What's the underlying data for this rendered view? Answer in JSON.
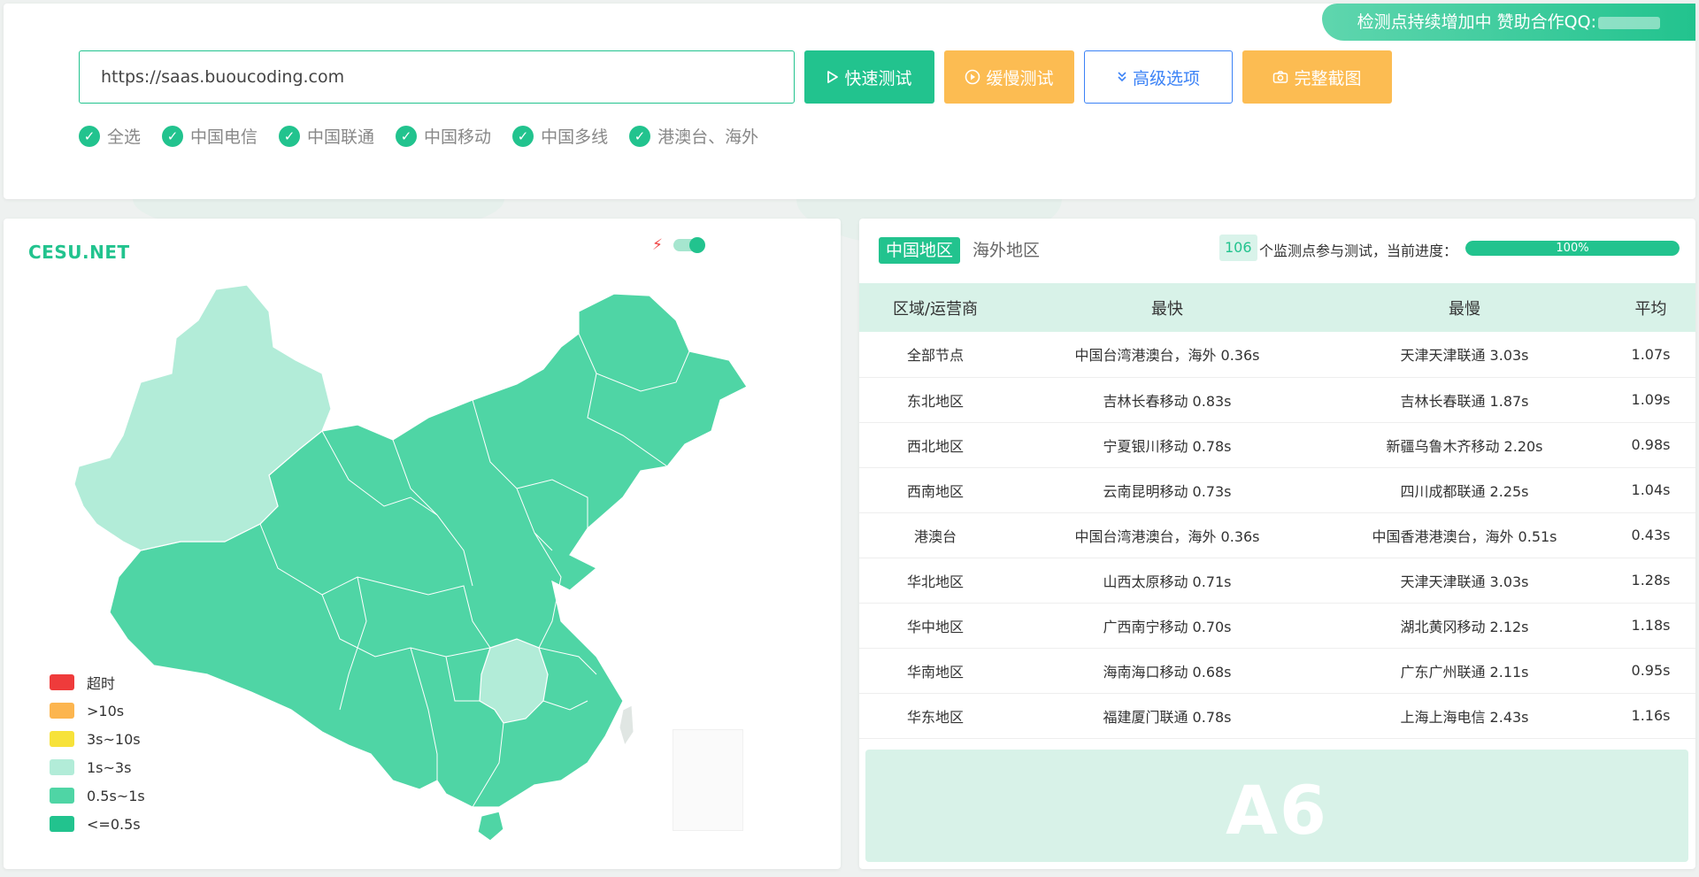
{
  "promo": {
    "text": "检测点持续增加中 赞助合作QQ:"
  },
  "url_input": {
    "value": "https://saas.buoucoding.com"
  },
  "buttons": {
    "fast": "快速测试",
    "slow": "缓慢测试",
    "advanced": "高级选项",
    "screenshot": "完整截图"
  },
  "isp_filters": [
    "全选",
    "中国电信",
    "中国联通",
    "中国移动",
    "中国多线",
    "港澳台、海外"
  ],
  "map": {
    "logo": "CESU.NET",
    "legend": [
      {
        "label": "超时",
        "color": "#ef3b3b"
      },
      {
        "label": ">10s",
        "color": "#fcb54f"
      },
      {
        "label": "3s~10s",
        "color": "#f7e23a"
      },
      {
        "label": "1s~3s",
        "color": "#b2ecd8"
      },
      {
        "label": "0.5s~1s",
        "color": "#4fd5a5"
      },
      {
        "label": "<=0.5s",
        "color": "#22c38e"
      }
    ]
  },
  "results": {
    "tabs": [
      "中国地区",
      "海外地区"
    ],
    "node_count": "106",
    "count_text": "个监测点参与测试，当前进度：",
    "progress": 100,
    "progress_label": "100%",
    "columns": [
      "区域/运营商",
      "最快",
      "最慢",
      "平均"
    ],
    "rows": [
      [
        "全部节点",
        "中国台湾港澳台，海外 0.36s",
        "天津天津联通 3.03s",
        "1.07s"
      ],
      [
        "东北地区",
        "吉林长春移动 0.83s",
        "吉林长春联通 1.87s",
        "1.09s"
      ],
      [
        "西北地区",
        "宁夏银川移动 0.78s",
        "新疆乌鲁木齐移动 2.20s",
        "0.98s"
      ],
      [
        "西南地区",
        "云南昆明移动 0.73s",
        "四川成都联通 2.25s",
        "1.04s"
      ],
      [
        "港澳台",
        "中国台湾港澳台，海外 0.36s",
        "中国香港港澳台，海外 0.51s",
        "0.43s"
      ],
      [
        "华北地区",
        "山西太原移动 0.71s",
        "天津天津联通 3.03s",
        "1.28s"
      ],
      [
        "华中地区",
        "广西南宁移动 0.70s",
        "湖北黄冈移动 2.12s",
        "1.18s"
      ],
      [
        "华南地区",
        "海南海口移动 0.68s",
        "广东广州联通 2.11s",
        "0.95s"
      ],
      [
        "华东地区",
        "福建厦门联通 0.78s",
        "上海上海电信 2.43s",
        "1.16s"
      ]
    ],
    "ad_text": "A6"
  }
}
